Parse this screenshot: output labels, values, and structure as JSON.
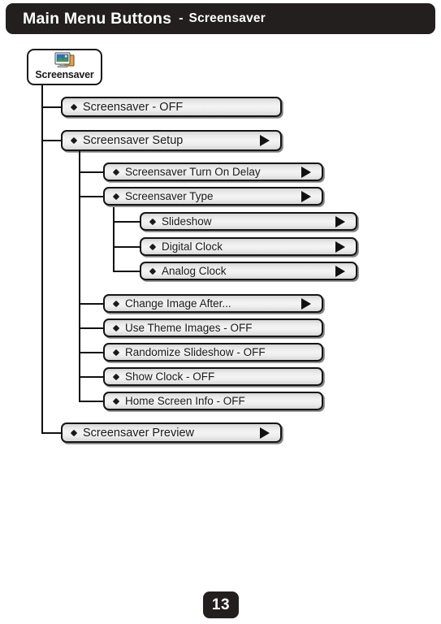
{
  "header": {
    "title": "Main Menu Buttons",
    "dash": "-",
    "subtitle": "Screensaver"
  },
  "root_node": {
    "label": "Screensaver",
    "icon": "screensaver-picture-icon"
  },
  "menu": {
    "level1": [
      {
        "label": "Screensaver - OFF",
        "arrow": false,
        "bullet": "diamond-bullet"
      },
      {
        "label": "Screensaver Setup",
        "arrow": true,
        "bullet": "diamond-bullet"
      },
      {
        "label": "Screensaver Preview",
        "arrow": true,
        "bullet": "diamond-bullet"
      }
    ],
    "level2": [
      {
        "label": "Screensaver Turn On Delay",
        "arrow": true,
        "bullet": "diamond-bullet"
      },
      {
        "label": "Screensaver Type",
        "arrow": true,
        "bullet": "diamond-bullet"
      },
      {
        "label": "Change Image After...",
        "arrow": true,
        "bullet": "diamond-bullet"
      },
      {
        "label": "Use Theme Images - OFF",
        "arrow": false,
        "bullet": "diamond-bullet"
      },
      {
        "label": "Randomize Slideshow - OFF",
        "arrow": false,
        "bullet": "diamond-bullet"
      },
      {
        "label": "Show Clock - OFF",
        "arrow": false,
        "bullet": "diamond-bullet"
      },
      {
        "label": "Home Screen Info - OFF",
        "arrow": false,
        "bullet": "diamond-bullet"
      }
    ],
    "level3": [
      {
        "label": "Slideshow",
        "arrow": true,
        "bullet": "diamond-bullet"
      },
      {
        "label": "Digital Clock",
        "arrow": true,
        "bullet": "diamond-bullet"
      },
      {
        "label": "Analog Clock",
        "arrow": true,
        "bullet": "diamond-bullet"
      }
    ]
  },
  "footer": {
    "page_number": "13"
  },
  "colors": {
    "header_bg": "#231f1f",
    "header_text": "#ffffff",
    "button_border": "#151515",
    "button_fill": "#f0f0f0",
    "line": "#111111",
    "page_bg": "#ffffff"
  }
}
